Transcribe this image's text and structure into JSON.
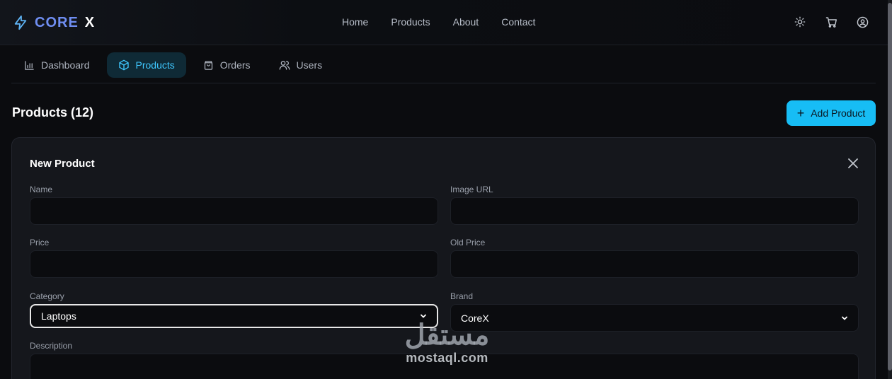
{
  "brand": {
    "name_primary": "CORE",
    "name_secondary": "X"
  },
  "nav": {
    "links": [
      "Home",
      "Products",
      "About",
      "Contact"
    ]
  },
  "icons": {
    "theme": "sun-icon",
    "cart": "cart-icon",
    "account": "user-circle-icon",
    "close": "close-icon"
  },
  "tabs": [
    {
      "label": "Dashboard",
      "icon": "bar-chart-icon"
    },
    {
      "label": "Products",
      "icon": "box-icon",
      "active": true
    },
    {
      "label": "Orders",
      "icon": "bag-icon"
    },
    {
      "label": "Users",
      "icon": "users-icon"
    }
  ],
  "header": {
    "title": "Products (12)",
    "add_label": "Add Product"
  },
  "form": {
    "title": "New Product",
    "name_label": "Name",
    "name_value": "",
    "image_label": "Image URL",
    "image_value": "",
    "price_label": "Price",
    "price_value": "",
    "old_price_label": "Old Price",
    "old_price_value": "",
    "category_label": "Category",
    "category_value": "Laptops",
    "brand_label": "Brand",
    "brand_value": "CoreX",
    "description_label": "Description",
    "description_value": ""
  },
  "watermark": {
    "arabic": "مستقل",
    "latin": "mostaql.com"
  },
  "colors": {
    "accent": "#17bdf5",
    "active_tab_bg": "#0f2a36",
    "brand_blue": "#6f8ef2",
    "page_bg": "#0b0c0f",
    "card_bg": "#15171c"
  }
}
